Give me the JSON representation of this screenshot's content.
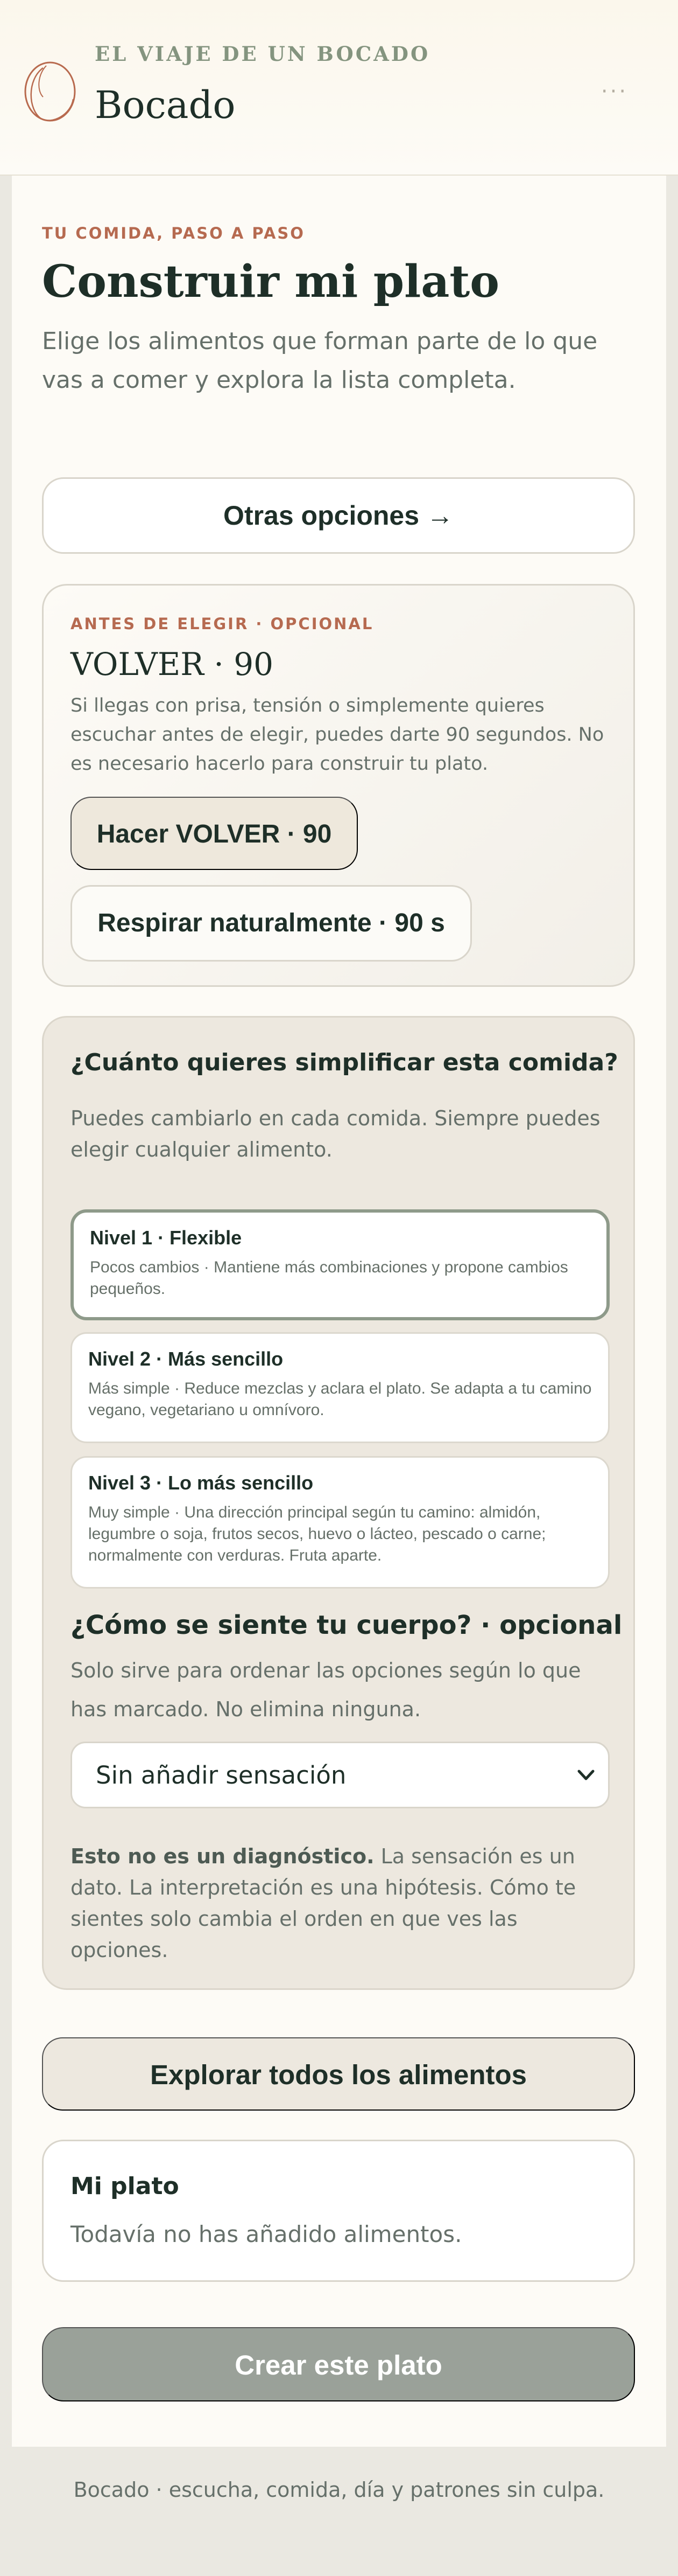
{
  "header": {
    "kicker": "EL VIAJE DE UN BOCADO",
    "brand": "Bocado",
    "menu_glyph": "···",
    "logo_icon": "circle-stroke-logo",
    "menu_icon": "more-dots-icon"
  },
  "intro": {
    "kicker": "TU COMIDA, PASO A PASO",
    "title": "Construir mi plato",
    "subtitle": "Elige los alimentos que forman parte de lo que vas a comer y explora la lista completa."
  },
  "other_options_label": "Otras opciones →",
  "volver": {
    "kicker": "ANTES DE ELEGIR · OPCIONAL",
    "title": "VOLVER · 90",
    "description": "Si llegas con prisa, tensión o simplemente quieres escuchar antes de elegir, puedes darte 90 segundos. No es necesario hacerlo para construir tu plato.",
    "primary_label": "Hacer VOLVER · 90",
    "secondary_label": "Respirar naturalmente · 90 s"
  },
  "simplify": {
    "question": "¿Cuánto quieres simplificar esta comida?",
    "subtitle": "Puedes cambiarlo en cada comida. Siempre puedes elegir cualquier alimento.",
    "levels": [
      {
        "name": "Nivel 1 · Flexible",
        "description": "Pocos cambios · Mantiene más combinaciones y propone cambios pequeños.",
        "selected": true
      },
      {
        "name": "Nivel 2 · Más sencillo",
        "description": "Más simple · Reduce mezclas y aclara el plato. Se adapta a tu camino vegano, vegetariano u omnívoro.",
        "selected": false
      },
      {
        "name": "Nivel 3 · Lo más sencillo",
        "description": "Muy simple · Una dirección principal según tu camino: almidón, legumbre o soja, frutos secos, huevo o lácteo, pescado o carne; normalmente con verduras. Fruta aparte.",
        "selected": false
      }
    ]
  },
  "body": {
    "question": "¿Cómo se siente tu cuerpo? · opcional",
    "subtitle": "Solo sirve para ordenar las opciones según lo que has marcado. No elimina ninguna.",
    "select_value": "Sin añadir sensación",
    "disclaimer_bold": "Esto no es un diagnóstico.",
    "disclaimer_rest": " La sensación es un dato. La interpretación es una hipótesis. Cómo te sientes solo cambia el orden en que ves las opciones."
  },
  "explore_label": "Explorar todos los alimentos",
  "plate": {
    "title": "Mi plato",
    "empty": "Todavía no has añadido alimentos."
  },
  "create_label": "Crear este plato",
  "footer": "Bocado · escucha, comida, día y patrones sin culpa.",
  "colors": {
    "accent_terracotta": "#b66a50",
    "sage": "#84947f",
    "ink": "#1e2f28",
    "muted": "#66706a",
    "card_beige": "#ede8df",
    "button_disabled": "#9aa199"
  }
}
